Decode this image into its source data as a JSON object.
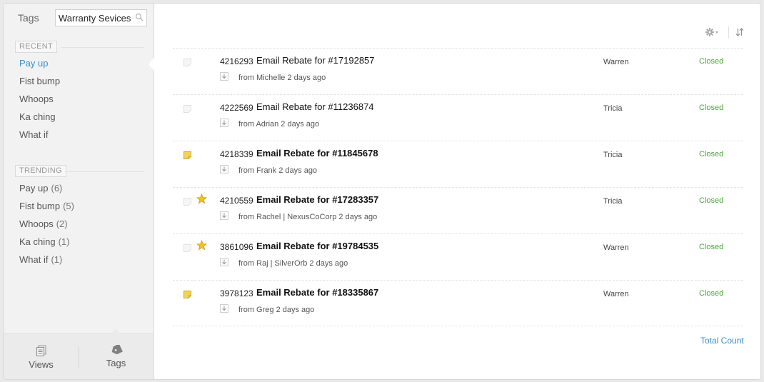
{
  "sidebar": {
    "title": "Tags",
    "search": {
      "value": "Warranty Sevices",
      "placeholder": ""
    },
    "recent": {
      "label": "RECENT",
      "items": [
        {
          "label": "Pay up",
          "active": true
        },
        {
          "label": "Fist bump"
        },
        {
          "label": "Whoops"
        },
        {
          "label": "Ka ching"
        },
        {
          "label": "What if"
        }
      ]
    },
    "trending": {
      "label": "TRENDING",
      "items": [
        {
          "label": "Pay up",
          "count": "(6)"
        },
        {
          "label": "Fist bump",
          "count": "(5)"
        },
        {
          "label": "Whoops",
          "count": "(2)"
        },
        {
          "label": "Ka ching",
          "count": "(1)"
        },
        {
          "label": "What if",
          "count": "(1)"
        }
      ]
    },
    "footer": {
      "views_label": "Views",
      "tags_label": "Tags"
    }
  },
  "tickets": [
    {
      "id": "4216293",
      "subject": "Email Rebate for #17192857",
      "from": "from  Michelle 2 days ago",
      "agent": "Warren",
      "status": "Closed",
      "bold": false,
      "flag": "none",
      "starred": false
    },
    {
      "id": "4222569",
      "subject": "Email Rebate for #11236874",
      "from": "from  Adrian 2 days ago",
      "agent": "Tricia",
      "status": "Closed",
      "bold": false,
      "flag": "none",
      "starred": false
    },
    {
      "id": "4218339",
      "subject": "Email Rebate for #11845678",
      "from": "from  Frank 2 days ago",
      "agent": "Tricia",
      "status": "Closed",
      "bold": true,
      "flag": "note",
      "starred": false
    },
    {
      "id": "4210559",
      "subject": "Email Rebate for #17283357",
      "from": "from  Rachel | NexusCoCorp 2 days ago",
      "agent": "Tricia",
      "status": "Closed",
      "bold": true,
      "flag": "none",
      "starred": true
    },
    {
      "id": "3861096",
      "subject": "Email Rebate for #19784535",
      "from": "from  Raj | SilverOrb 2 days ago",
      "agent": "Warren",
      "status": "Closed",
      "bold": true,
      "flag": "none",
      "starred": true
    },
    {
      "id": "3978123",
      "subject": "Email Rebate for #18335867",
      "from": "from  Greg 2 days ago",
      "agent": "Warren",
      "status": "Closed",
      "bold": true,
      "flag": "note",
      "starred": false
    }
  ],
  "total_count_label": "Total Count",
  "colors": {
    "accent": "#3a8fc7",
    "status_closed": "#4aa63b",
    "note": "#f1d55a",
    "star": "#f2c31e"
  }
}
